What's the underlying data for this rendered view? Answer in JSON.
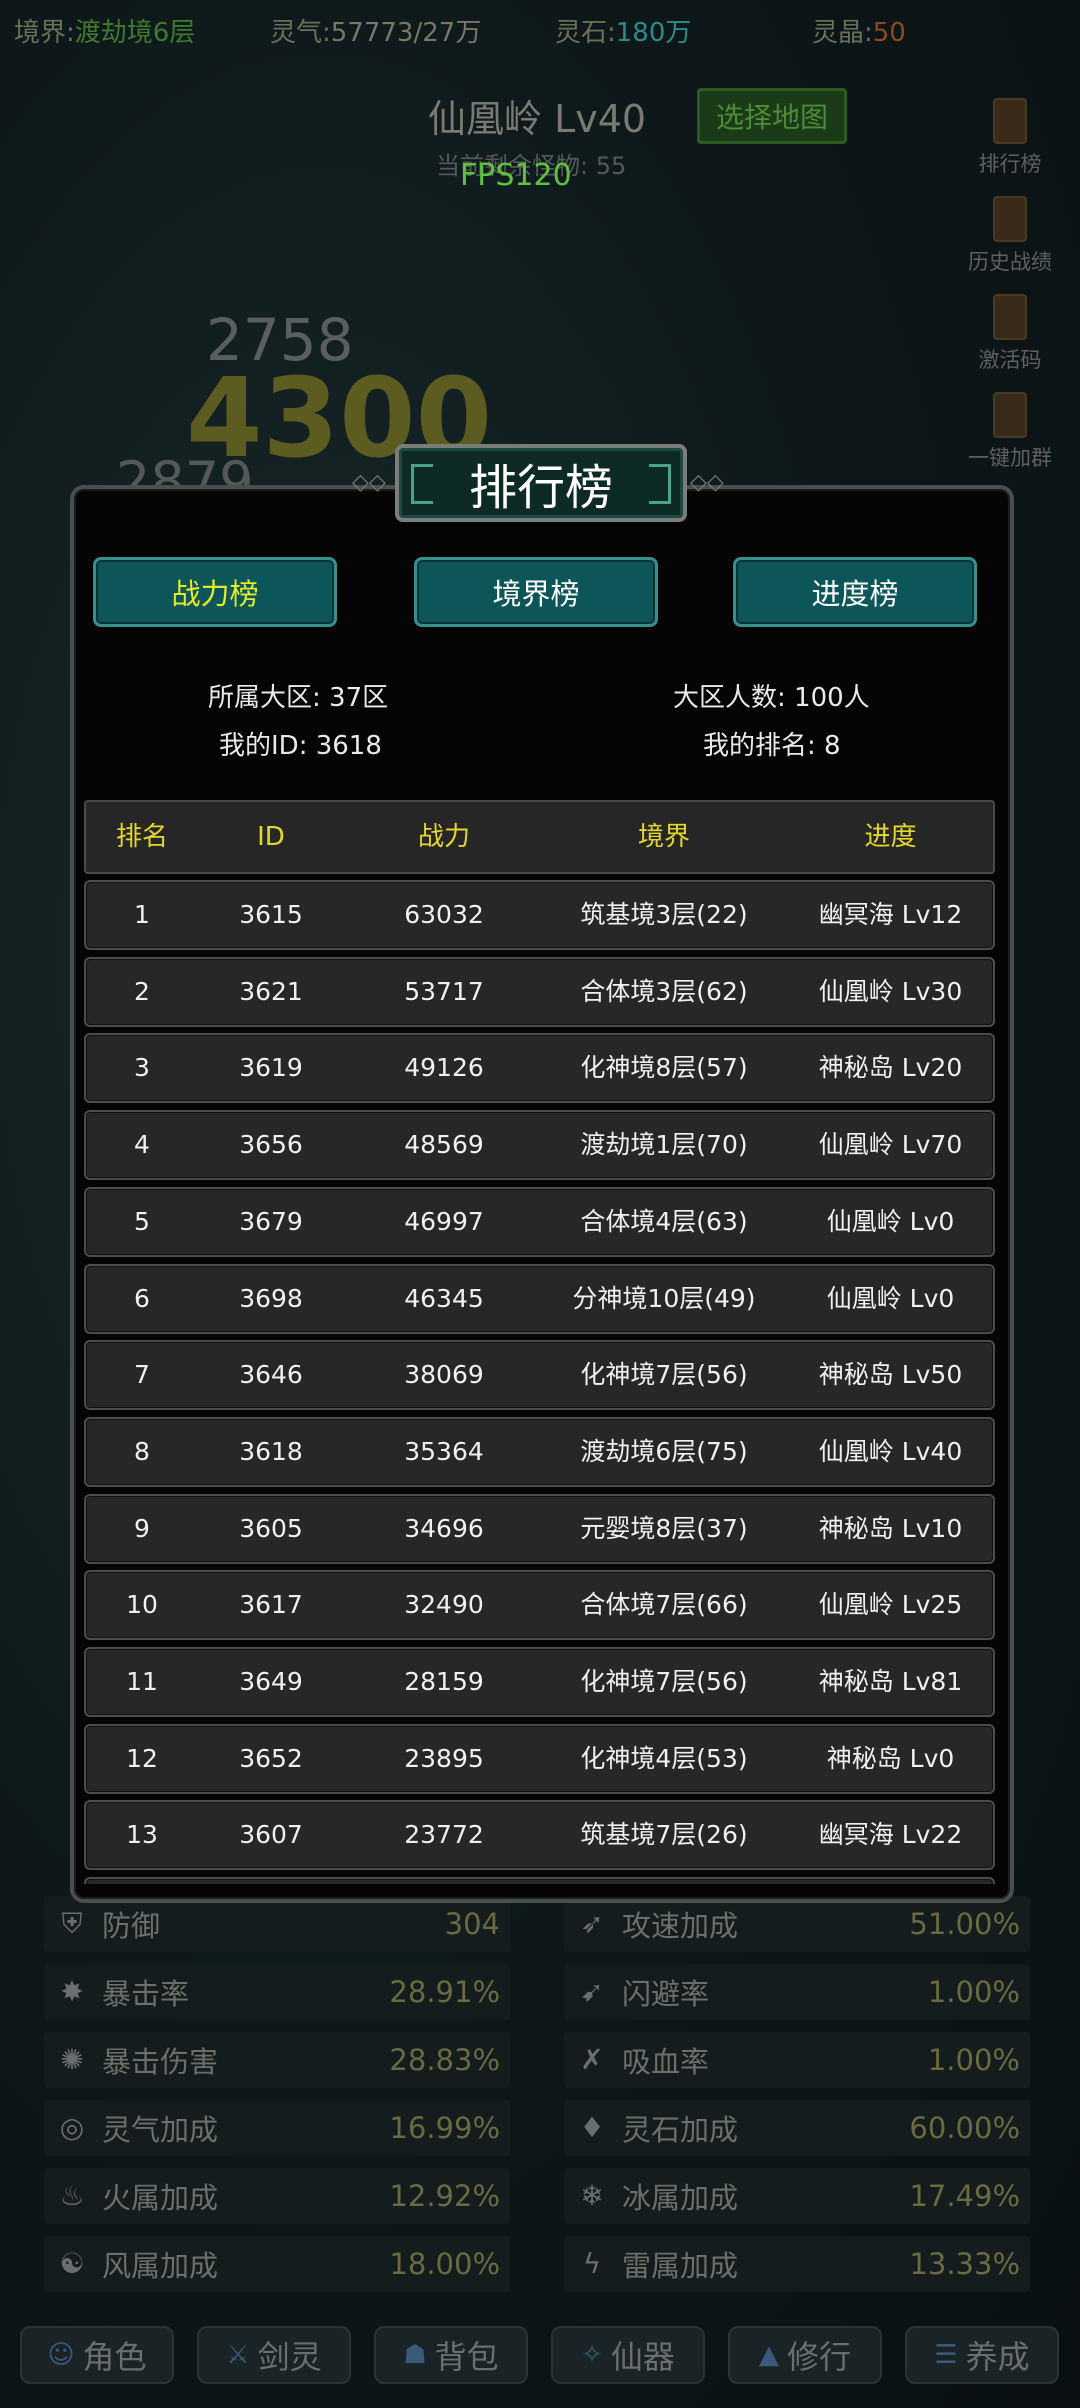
{
  "topbar": {
    "realm_label": "境界:",
    "realm_value": "渡劫境6层",
    "qi_label": "灵气:",
    "qi_value": "57773/27万",
    "stone_label": "灵石:",
    "stone_value": "180万",
    "crystal_label": "灵晶:",
    "crystal_value": "50"
  },
  "scene": {
    "map_title": "仙凰岭 Lv40",
    "map_button": "选择地图",
    "remaining": "当前剩余怪物: 55",
    "fps": "FPS120",
    "damage_numbers": [
      "2758",
      "4300",
      "2879"
    ]
  },
  "side_menu": [
    {
      "label": "排行榜",
      "icon": "leaderboard-icon"
    },
    {
      "label": "历史战绩",
      "icon": "history-icon"
    },
    {
      "label": "激活码",
      "icon": "code-icon"
    },
    {
      "label": "一键加群",
      "icon": "group-icon"
    }
  ],
  "modal": {
    "title": "排行榜",
    "tabs": [
      "战力榜",
      "境界榜",
      "进度榜"
    ],
    "active_tab": 0,
    "info": {
      "region": "所属大区: 37区",
      "region_count": "大区人数: 100人",
      "my_id": "我的ID: 3618",
      "my_rank": "我的排名: 8"
    },
    "columns": [
      "排名",
      "ID",
      "战力",
      "境界",
      "进度"
    ],
    "rows": [
      [
        "1",
        "3615",
        "63032",
        "筑基境3层(22)",
        "幽冥海 Lv12"
      ],
      [
        "2",
        "3621",
        "53717",
        "合体境3层(62)",
        "仙凰岭 Lv30"
      ],
      [
        "3",
        "3619",
        "49126",
        "化神境8层(57)",
        "神秘岛 Lv20"
      ],
      [
        "4",
        "3656",
        "48569",
        "渡劫境1层(70)",
        "仙凰岭 Lv70"
      ],
      [
        "5",
        "3679",
        "46997",
        "合体境4层(63)",
        "仙凰岭 Lv0"
      ],
      [
        "6",
        "3698",
        "46345",
        "分神境10层(49)",
        "仙凰岭 Lv0"
      ],
      [
        "7",
        "3646",
        "38069",
        "化神境7层(56)",
        "神秘岛 Lv50"
      ],
      [
        "8",
        "3618",
        "35364",
        "渡劫境6层(75)",
        "仙凰岭 Lv40"
      ],
      [
        "9",
        "3605",
        "34696",
        "元婴境8层(37)",
        "神秘岛 Lv10"
      ],
      [
        "10",
        "3617",
        "32490",
        "合体境7层(66)",
        "仙凰岭 Lv25"
      ],
      [
        "11",
        "3649",
        "28159",
        "化神境7层(56)",
        "神秘岛 Lv81"
      ],
      [
        "12",
        "3652",
        "23895",
        "化神境4层(53)",
        "神秘岛 Lv0"
      ],
      [
        "13",
        "3607",
        "23772",
        "筑基境7层(26)",
        "幽冥海 Lv22"
      ]
    ]
  },
  "stats": [
    {
      "name": "防御",
      "value": "304",
      "icon": "defense-icon"
    },
    {
      "name": "攻速加成",
      "value": "51.00%",
      "icon": "attack-speed-icon"
    },
    {
      "name": "暴击率",
      "value": "28.91%",
      "icon": "crit-rate-icon"
    },
    {
      "name": "闪避率",
      "value": "1.00%",
      "icon": "dodge-icon"
    },
    {
      "name": "暴击伤害",
      "value": "28.83%",
      "icon": "crit-damage-icon"
    },
    {
      "name": "吸血率",
      "value": "1.00%",
      "icon": "lifesteal-icon"
    },
    {
      "name": "灵气加成",
      "value": "16.99%",
      "icon": "qi-bonus-icon"
    },
    {
      "name": "灵石加成",
      "value": "60.00%",
      "icon": "stone-bonus-icon"
    },
    {
      "name": "火属加成",
      "value": "12.92%",
      "icon": "fire-icon"
    },
    {
      "name": "冰属加成",
      "value": "17.49%",
      "icon": "ice-icon"
    },
    {
      "name": "风属加成",
      "value": "18.00%",
      "icon": "wind-icon"
    },
    {
      "name": "雷属加成",
      "value": "13.33%",
      "icon": "thunder-icon"
    }
  ],
  "bottom_nav": [
    "角色",
    "剑灵",
    "背包",
    "仙器",
    "修行",
    "养成"
  ]
}
